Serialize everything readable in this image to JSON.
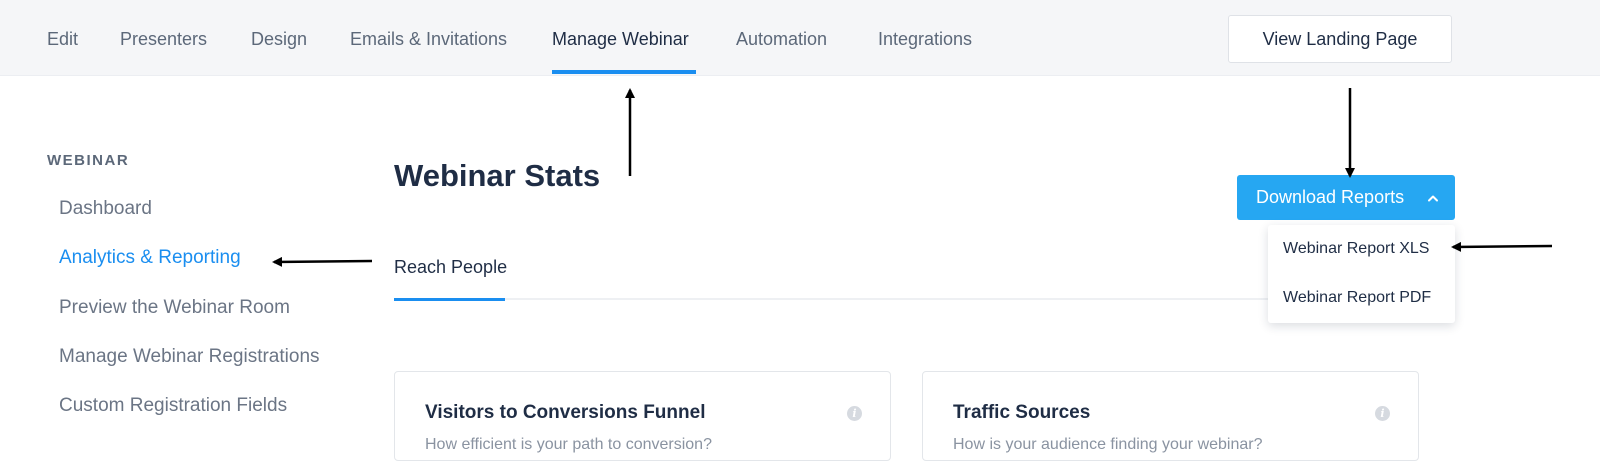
{
  "top_nav": {
    "tabs": [
      {
        "label": "Edit",
        "active": false
      },
      {
        "label": "Presenters",
        "active": false
      },
      {
        "label": "Design",
        "active": false
      },
      {
        "label": "Emails & Invitations",
        "active": false
      },
      {
        "label": "Manage Webinar",
        "active": true
      },
      {
        "label": "Automation",
        "active": false
      },
      {
        "label": "Integrations",
        "active": false
      }
    ],
    "view_landing_page_label": "View Landing Page"
  },
  "sidebar": {
    "heading": "WEBINAR",
    "items": [
      {
        "label": "Dashboard",
        "active": false
      },
      {
        "label": "Analytics & Reporting",
        "active": true
      },
      {
        "label": "Preview the Webinar Room",
        "active": false
      },
      {
        "label": "Manage Webinar Registrations",
        "active": false
      },
      {
        "label": "Custom Registration Fields",
        "active": false
      }
    ]
  },
  "main": {
    "title": "Webinar Stats",
    "sub_tabs": [
      {
        "label": "Reach People",
        "active": true
      }
    ],
    "download_button_label": "Download Reports",
    "dropdown_items": [
      {
        "label": "Webinar Report XLS"
      },
      {
        "label": "Webinar Report PDF"
      }
    ],
    "cards": [
      {
        "title": "Visitors to Conversions Funnel",
        "description": "How efficient is your path to conversion?"
      },
      {
        "title": "Traffic Sources",
        "description": "How is your audience finding your webinar?"
      }
    ]
  },
  "colors": {
    "accent": "#1a8ef0",
    "download_button": "#26a7f2",
    "topbar_bg": "#f5f6f8",
    "annotation_arrow": "#000000"
  },
  "icons": [
    "chevron-up-icon",
    "info-icon",
    "annotation-arrow"
  ]
}
